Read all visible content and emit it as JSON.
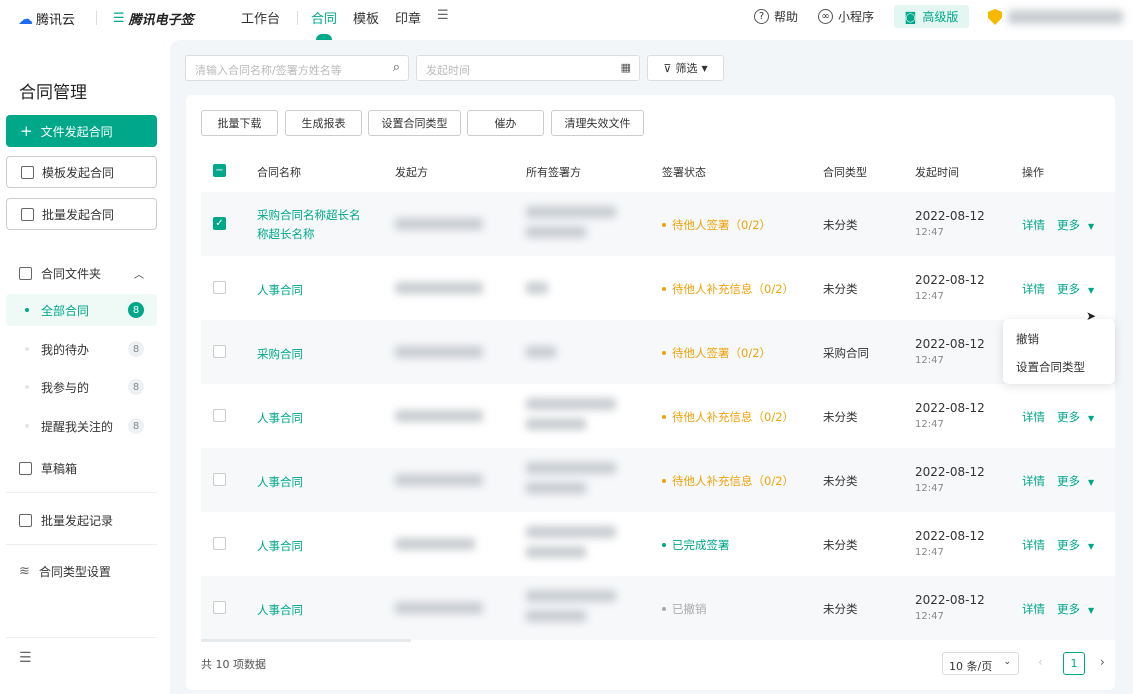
{
  "header": {
    "brand": "腾讯云",
    "product": "腾讯电子签",
    "nav": [
      "工作台",
      "合同",
      "模板",
      "印章"
    ],
    "active_nav": "合同",
    "help": "帮助",
    "mini_program": "小程序",
    "plan": "高级版"
  },
  "sidebar": {
    "title": "合同管理",
    "primary_button": "文件发起合同",
    "template_button": "模板发起合同",
    "batch_button": "批量发起合同",
    "folder": "合同文件夹",
    "folder_items": [
      {
        "label": "全部合同",
        "count": "8"
      },
      {
        "label": "我的待办",
        "count": "8"
      },
      {
        "label": "我参与的",
        "count": "8"
      },
      {
        "label": "提醒我关注的",
        "count": "8"
      }
    ],
    "drafts": "草稿箱",
    "batch_records": "批量发起记录",
    "type_settings": "合同类型设置"
  },
  "filters": {
    "search_placeholder": "清输入合同名称/签署方姓名等",
    "date_placeholder": "发起时间",
    "filter_label": "筛选"
  },
  "toolbar": [
    "批量下载",
    "生成报表",
    "设置合同类型",
    "催办",
    "清理失效文件"
  ],
  "table": {
    "columns": [
      "合同名称",
      "发起方",
      "所有签署方",
      "签署状态",
      "合同类型",
      "发起时间",
      "操作"
    ],
    "rows": [
      {
        "name": "采购合同名称超长名称超长名称",
        "checked": true,
        "status": "待他人签署（0/2）",
        "status_color": "#f0a30a",
        "type": "未分类",
        "date": "2022-08-12",
        "time": "12:47"
      },
      {
        "name": "人事合同",
        "checked": false,
        "status": "待他人补充信息（0/2）",
        "status_color": "#f0a30a",
        "type": "未分类",
        "date": "2022-08-12",
        "time": "12:47"
      },
      {
        "name": "采购合同",
        "checked": false,
        "status": "待他人签署（0/2）",
        "status_color": "#f0a30a",
        "type": "采购合同",
        "date": "2022-08-12",
        "time": "12:47"
      },
      {
        "name": "人事合同",
        "checked": false,
        "status": "待他人补充信息（0/2）",
        "status_color": "#f0a30a",
        "type": "未分类",
        "date": "2022-08-12",
        "time": "12:47"
      },
      {
        "name": "人事合同",
        "checked": false,
        "status": "待他人补充信息（0/2）",
        "status_color": "#f0a30a",
        "type": "未分类",
        "date": "2022-08-12",
        "time": "12:47"
      },
      {
        "name": "人事合同",
        "checked": false,
        "status": "已完成签署",
        "status_color": "#00a88a",
        "type": "未分类",
        "date": "2022-08-12",
        "time": "12:47"
      },
      {
        "name": "人事合同",
        "checked": false,
        "status": "已撤销",
        "status_color": "#aaaaaa",
        "type": "未分类",
        "date": "2022-08-12",
        "time": "12:47"
      }
    ],
    "detail": "详情",
    "more": "更多"
  },
  "dropdown": {
    "items": [
      "撤销",
      "设置合同类型"
    ]
  },
  "footer": {
    "total": "共 10 项数据",
    "page_size": "10 条/页",
    "page": "1"
  },
  "colors": {
    "accent": "#00a88a"
  }
}
